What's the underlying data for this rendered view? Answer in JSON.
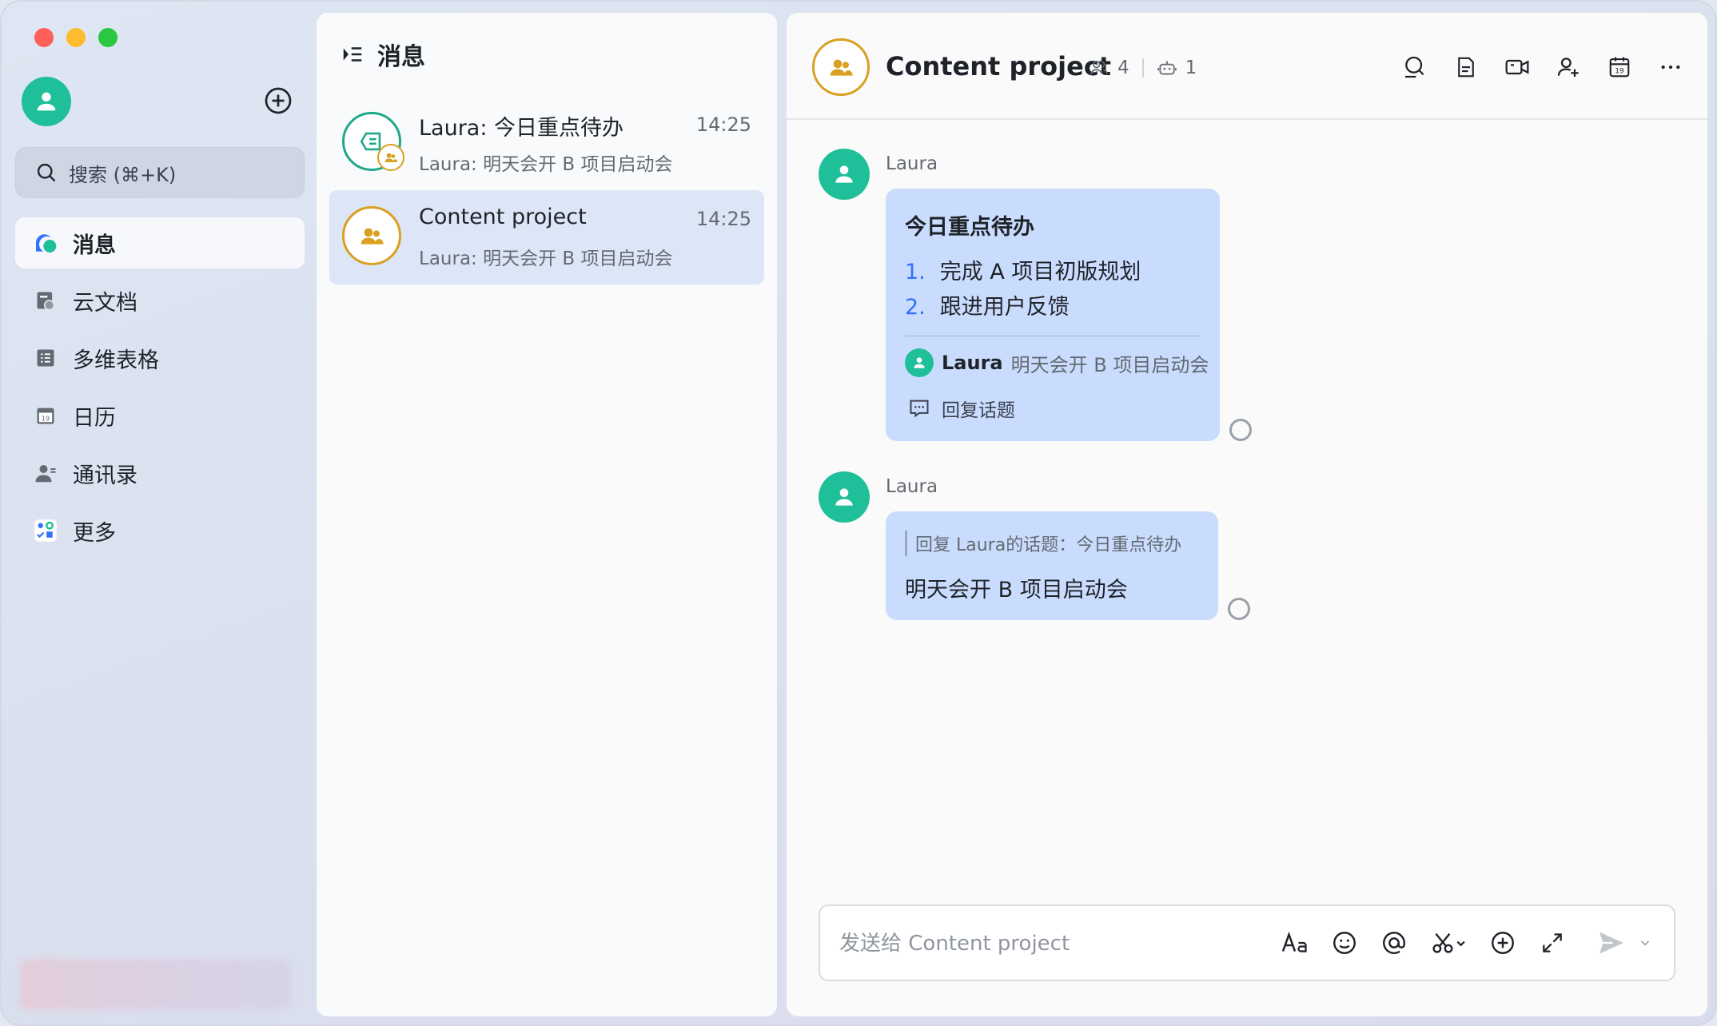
{
  "sidebar": {
    "search_placeholder": "搜索 (⌘+K)",
    "items": [
      {
        "label": "消息",
        "icon": "message-icon",
        "active": true
      },
      {
        "label": "云文档",
        "icon": "cloud-doc-icon"
      },
      {
        "label": "多维表格",
        "icon": "base-table-icon"
      },
      {
        "label": "日历",
        "icon": "calendar-icon"
      },
      {
        "label": "通讯录",
        "icon": "contacts-icon"
      },
      {
        "label": "更多",
        "icon": "more-apps-icon"
      }
    ]
  },
  "list": {
    "header": "消息",
    "conversations": [
      {
        "title": "Laura: 今日重点待办",
        "time": "14:25",
        "preview": "Laura: 明天会开 B 项目启动会"
      },
      {
        "title": "Content project",
        "time": "14:25",
        "preview": "Laura: 明天会开 B 项目启动会"
      }
    ]
  },
  "chat": {
    "title": "Content project",
    "member_count": "4",
    "bot_count": "1",
    "messages": [
      {
        "sender": "Laura",
        "title": "今日重点待办",
        "items": [
          {
            "num": "1.",
            "text": "完成 A 项目初版规划"
          },
          {
            "num": "2.",
            "text": "跟进用户反馈"
          }
        ],
        "reply_name": "Laura",
        "reply_text": "明天会开 B 项目启动会",
        "topic_label": "回复话题"
      },
      {
        "sender": "Laura",
        "quote": "回复 Laura的话题：今日重点待办",
        "text": "明天会开 B 项目启动会"
      }
    ],
    "composer_placeholder": "发送给 Content project"
  },
  "colors": {
    "accent": "#3370ff",
    "avatar_green": "#1fbf9a",
    "group_gold": "#d9a021",
    "bubble": "#c9dcfd"
  }
}
